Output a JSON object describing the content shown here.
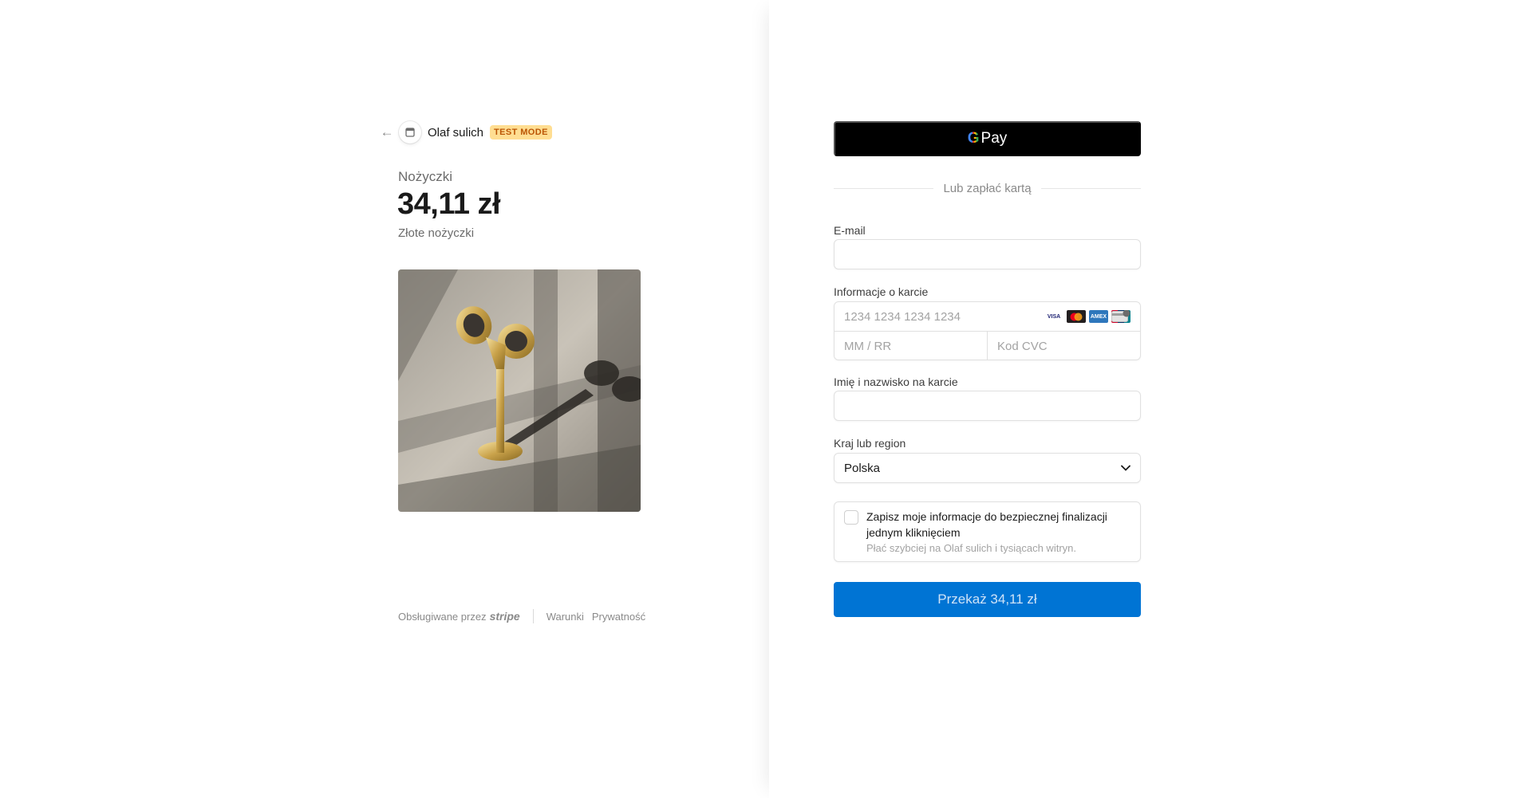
{
  "merchant": {
    "name": "Olaf sulich",
    "badge": "TEST MODE",
    "back_icon": "arrow-left-icon",
    "store_icon": "store-icon"
  },
  "product": {
    "name": "Nożyczki",
    "price": "34,11 zł",
    "description": "Złote nożyczki",
    "image_icon": "product-photo-golden-scissors"
  },
  "footer": {
    "powered_by": "Obsługiwane przez",
    "brand": "stripe",
    "terms": "Warunki",
    "privacy": "Prywatność"
  },
  "wallet": {
    "gpay_label": "Pay",
    "gpay_g": "G"
  },
  "divider_text": "Lub zapłać kartą",
  "form": {
    "email_label": "E-mail",
    "email_value": "",
    "card_label": "Informacje o karcie",
    "card_number_placeholder": "1234 1234 1234 1234",
    "expiry_placeholder": "MM / RR",
    "cvc_placeholder": "Kod CVC",
    "card_brands": [
      "VISA",
      "mastercard",
      "AMEX",
      "UnionPay"
    ],
    "name_label": "Imię i nazwisko na karcie",
    "name_value": "",
    "country_label": "Kraj lub region",
    "country_value": "Polska"
  },
  "save_info": {
    "checked": false,
    "title": "Zapisz moje informacje do bezpiecznej finalizacji jednym kliknięciem",
    "subtitle": "Płać szybciej na Olaf sulich i tysiącach witryn."
  },
  "pay_button": "Przekaż 34,11 zł",
  "colors": {
    "accent": "#0074d4",
    "badge_bg": "#ffde92",
    "badge_text": "#bb5504"
  }
}
